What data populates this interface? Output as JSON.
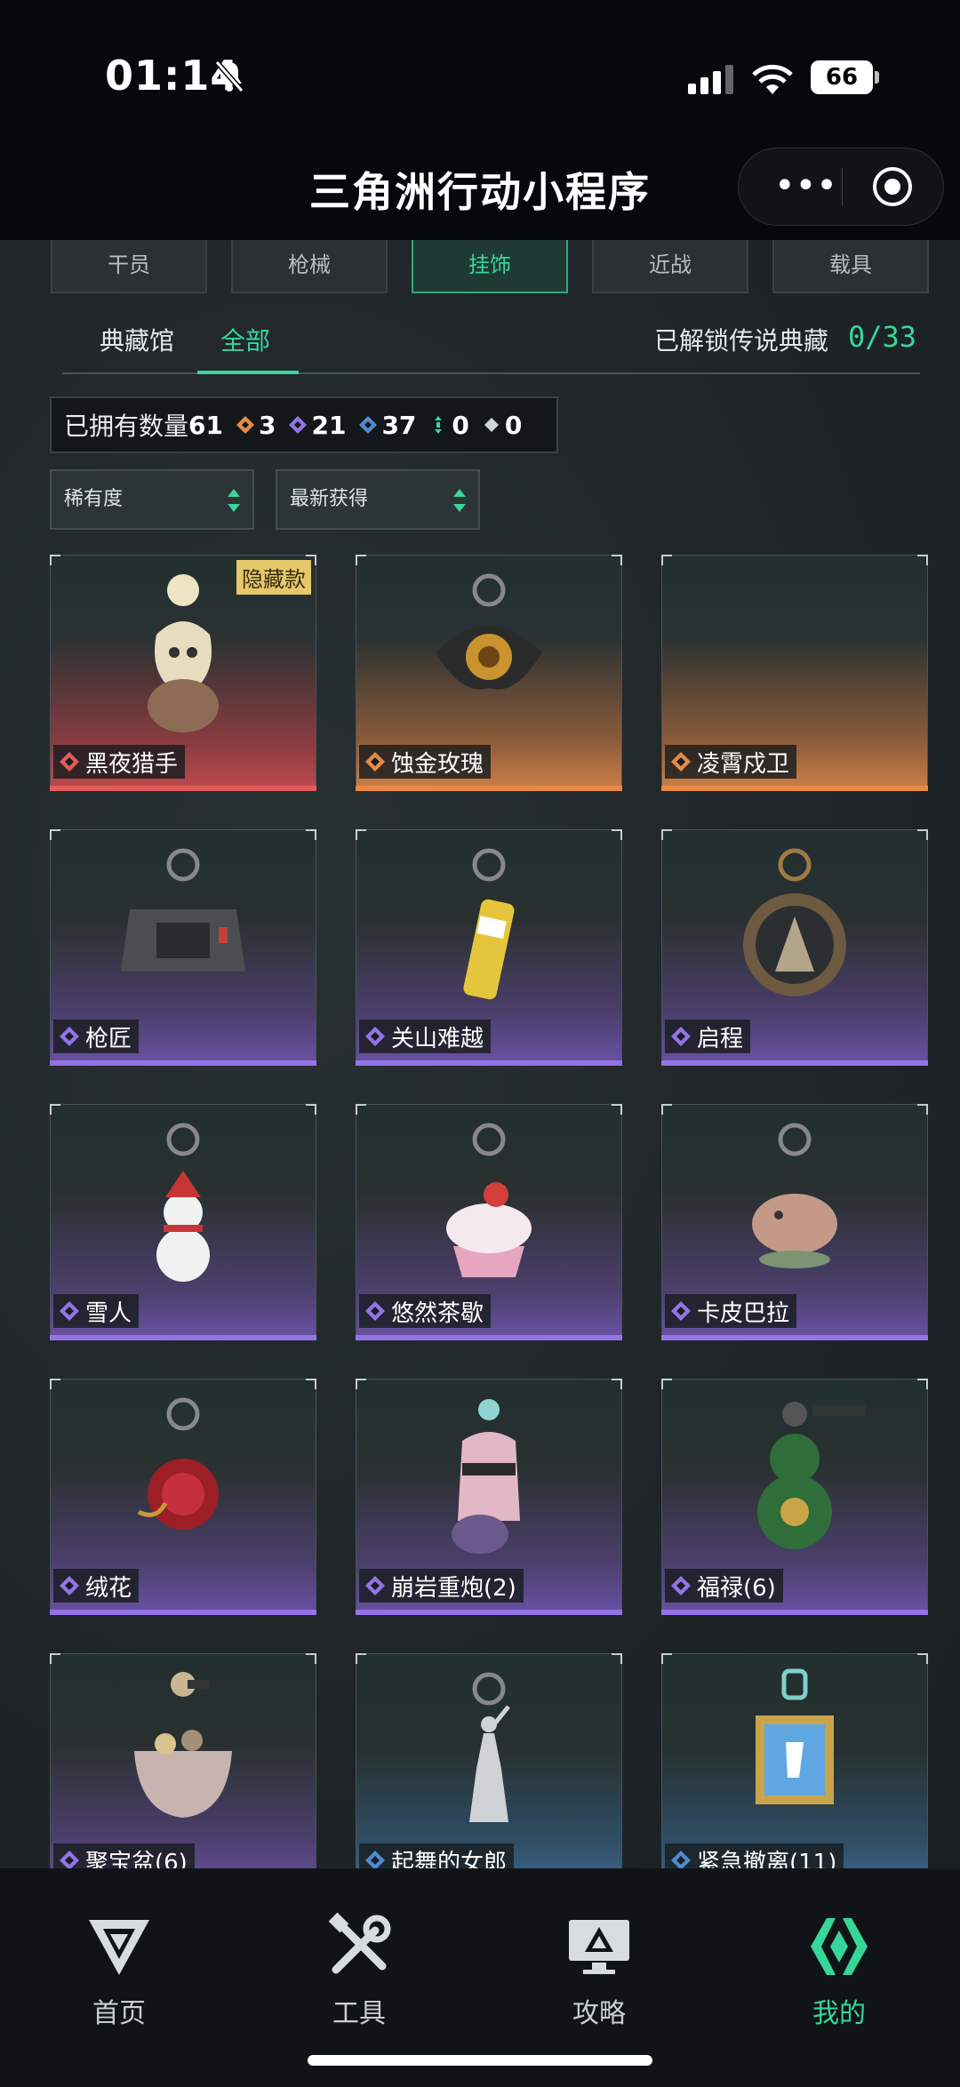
{
  "status": {
    "time": "01:14",
    "battery": "66"
  },
  "title": "三角洲行动小程序",
  "category_tabs": [
    {
      "label": "干员",
      "active": false
    },
    {
      "label": "枪械",
      "active": false
    },
    {
      "label": "挂饰",
      "active": true
    },
    {
      "label": "近战",
      "active": false
    },
    {
      "label": "载具",
      "active": false
    }
  ],
  "sub_tabs": {
    "museum": "典藏馆",
    "all": "全部"
  },
  "legend": {
    "label": "已解锁传说典藏",
    "count": "0/33"
  },
  "owned": {
    "label": "已拥有数量",
    "total": "61",
    "rarity_counts": [
      {
        "rarity": "orange",
        "count": "3"
      },
      {
        "rarity": "purple",
        "count": "21"
      },
      {
        "rarity": "blue",
        "count": "37"
      },
      {
        "rarity": "green",
        "count": "0"
      },
      {
        "rarity": "white",
        "count": "0"
      }
    ]
  },
  "filters": {
    "rarity": "稀有度",
    "sort": "最新获得"
  },
  "colors": {
    "accent": "#37d69a",
    "red": "#e25c5c",
    "orange": "#e88a44",
    "purple": "#9473e6",
    "blue": "#4e8ad0"
  },
  "items": [
    {
      "name": "黑夜猎手",
      "rarity": "red",
      "badge": "隐藏款",
      "icon": "white-rose-fox-charm"
    },
    {
      "name": "蚀金玫瑰",
      "rarity": "orange",
      "badge": "",
      "icon": "golden-rose-charm"
    },
    {
      "name": "凌霄戍卫",
      "rarity": "orange",
      "badge": "",
      "icon": ""
    },
    {
      "name": "枪匠",
      "rarity": "purple",
      "badge": "",
      "icon": "armor-plate-charm"
    },
    {
      "name": "关山难越",
      "rarity": "purple",
      "badge": "",
      "icon": "can-charm"
    },
    {
      "name": "启程",
      "rarity": "purple",
      "badge": "",
      "icon": "medal-charm"
    },
    {
      "name": "雪人",
      "rarity": "purple",
      "badge": "",
      "icon": "snowman-charm"
    },
    {
      "name": "悠然茶歇",
      "rarity": "purple",
      "badge": "",
      "icon": "cupcake-charm"
    },
    {
      "name": "卡皮巴拉",
      "rarity": "purple",
      "badge": "",
      "icon": "capybara-charm"
    },
    {
      "name": "绒花",
      "rarity": "purple",
      "badge": "",
      "icon": "red-rose-charm"
    },
    {
      "name": "崩岩重炮(2)",
      "rarity": "purple",
      "badge": "",
      "icon": "dog-figure-charm"
    },
    {
      "name": "福禄(6)",
      "rarity": "purple",
      "badge": "",
      "icon": "gourd-charm"
    },
    {
      "name": "聚宝盆(6)",
      "rarity": "purple",
      "badge": "",
      "icon": "treasure-bowl-charm"
    },
    {
      "name": "起舞的女郎",
      "rarity": "blue",
      "badge": "",
      "icon": "dancer-charm"
    },
    {
      "name": "紧急撤离(11)",
      "rarity": "blue",
      "badge": "",
      "icon": "exit-sign-charm"
    }
  ],
  "nav": [
    {
      "label": "首页",
      "icon": "delta-logo-icon",
      "active": false
    },
    {
      "label": "工具",
      "icon": "tools-icon",
      "active": false
    },
    {
      "label": "攻略",
      "icon": "guide-monitor-icon",
      "active": false
    },
    {
      "label": "我的",
      "icon": "profile-diamond-icon",
      "active": true
    }
  ]
}
